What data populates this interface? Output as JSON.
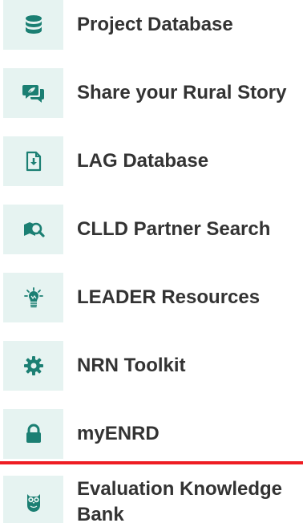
{
  "menu": {
    "items": [
      {
        "label": "Project Database",
        "icon": "database-icon"
      },
      {
        "label": "Share your Rural Story",
        "icon": "chat-bubbles-icon"
      },
      {
        "label": "LAG Database",
        "icon": "document-download-icon"
      },
      {
        "label": "CLLD Partner Search",
        "icon": "map-search-icon"
      },
      {
        "label": "LEADER Resources",
        "icon": "lightbulb-icon"
      },
      {
        "label": "NRN Toolkit",
        "icon": "gear-icon"
      },
      {
        "label": "myENRD",
        "icon": "lock-icon"
      },
      {
        "label": "Evaluation Knowledge Bank",
        "icon": "owl-icon"
      }
    ]
  },
  "colors": {
    "icon_color": "#1b7f73",
    "icon_bg": "#e6f3f1",
    "text": "#333333",
    "divider": "#ee1d23"
  }
}
